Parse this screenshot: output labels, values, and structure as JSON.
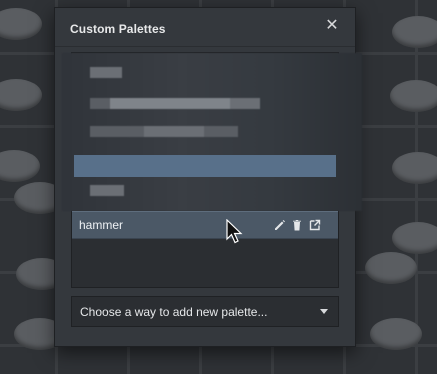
{
  "dialog": {
    "title": "Custom Palettes",
    "close_icon": "close-icon"
  },
  "palettes": {
    "items": [
      {
        "name": "hammer",
        "icons": [
          "pencil-icon",
          "trash-icon",
          "open-external-icon"
        ]
      }
    ]
  },
  "add_palette": {
    "selected_label": "Choose a way to add new palette..."
  },
  "colors": {
    "modal_bg": "#34383d",
    "selected_row": "#4b5866",
    "text": "#e8e9ea"
  }
}
